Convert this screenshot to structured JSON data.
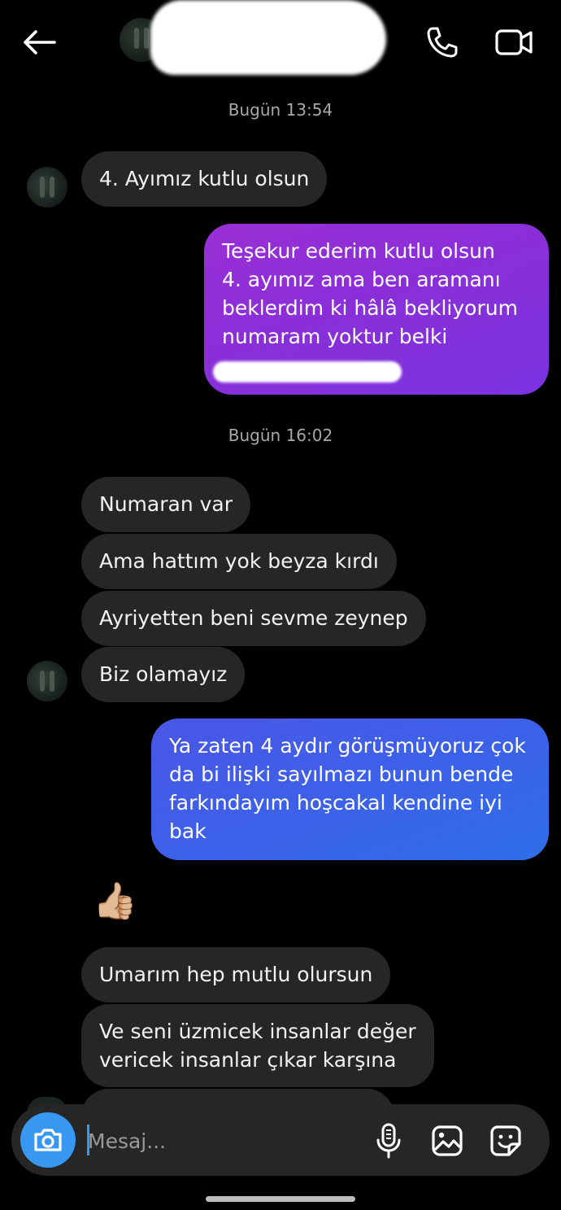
{
  "header": {
    "back_icon": "arrow-left-icon",
    "call_icon": "phone-icon",
    "video_icon": "video-camera-icon"
  },
  "messages": {
    "time_1": "Bugün 13:54",
    "m1": "4. Ayımız kutlu olsun",
    "out1": {
      "line1": "Teşekur ederim kutlu olsun",
      "line2": "4. ayımız ama ben aramanı",
      "line3": "beklerdim ki hâlâ bekliyorum",
      "line4": "numaram yoktur belki"
    },
    "time_2": "Bugün 16:02",
    "m2": "Numaran var",
    "m3": "Ama hattım yok beyza kırdı",
    "m4": "Ayriyetten beni sevme zeynep",
    "m5": "Biz olamayız",
    "out2": {
      "line1": "Ya zaten 4 aydır görüşmüyoruz çok",
      "line2": "da bi ilişki sayılmazı bunun bende",
      "line3": "farkındayım hoşcakal kendine iyi",
      "line4": "bak"
    },
    "reaction": "👍🏼",
    "m6": "Umarım hep mutlu olursun",
    "m7": {
      "line1": "Ve seni üzmicek insanlar değer",
      "line2": "vericek insanlar çıkar karşına"
    }
  },
  "composer": {
    "placeholder": "Mesaj...",
    "camera_icon": "camera-icon",
    "mic_icon": "microphone-icon",
    "gallery_icon": "image-icon",
    "sticker_icon": "sticker-icon"
  },
  "colors": {
    "background": "#000000",
    "incoming_bubble": "#262626",
    "outgoing_purple": "#8a2fd8",
    "outgoing_blue": "#3a63e8",
    "accent": "#3897f0"
  }
}
